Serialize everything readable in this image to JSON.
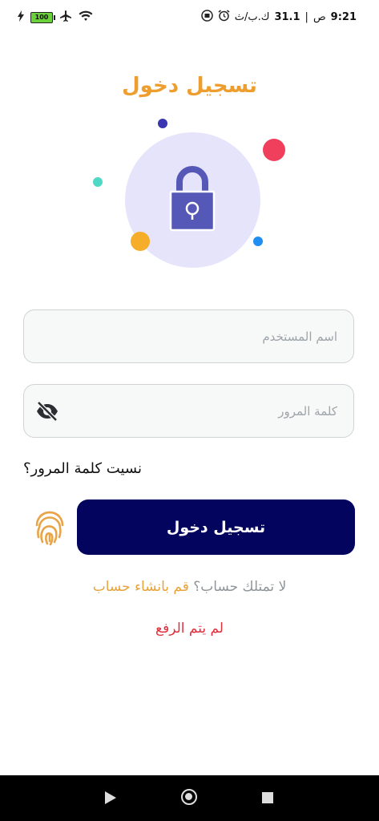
{
  "status_bar": {
    "battery": "100",
    "time": "9:21",
    "am_pm": "ص",
    "speed": "31.1",
    "speed_unit": "ك.ب/ث"
  },
  "title": "تسجيل دخول",
  "username": {
    "placeholder": "اسم المستخدم",
    "value": ""
  },
  "password": {
    "placeholder": "كلمة المرور",
    "value": ""
  },
  "forgot_password": "نسيت كلمة المرور؟",
  "login_button": "تسجيل دخول",
  "signup": {
    "question": "لا تمتلك حساب؟",
    "link": "قم بانشاء حساب"
  },
  "upload_status": "لم يتم الرفع",
  "colors": {
    "accent": "#ee9e2f",
    "primary_button": "#03045e",
    "error": "#e0303e"
  }
}
